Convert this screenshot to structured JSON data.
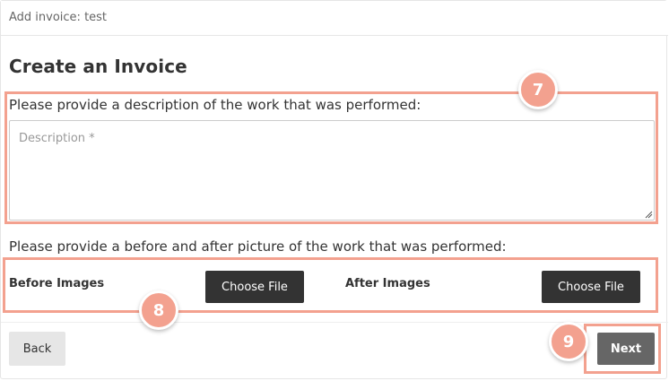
{
  "header": {
    "title": "Add invoice: test"
  },
  "form": {
    "title": "Create an Invoice",
    "description_prompt": "Please provide a description of the work that was performed:",
    "description_placeholder": "Description *",
    "description_value": "",
    "pictures_prompt": "Please provide a before and after picture of the work that was performed:",
    "before_label": "Before Images",
    "after_label": "After Images",
    "choose_file_label": "Choose File"
  },
  "footer": {
    "back_label": "Back",
    "next_label": "Next"
  },
  "annotations": [
    {
      "number": "7",
      "target": "description section"
    },
    {
      "number": "8",
      "target": "image upload section"
    },
    {
      "number": "9",
      "target": "next button"
    }
  ],
  "colors": {
    "annotation": "#f3a18f",
    "primary_button": "#333333",
    "next_button": "#666666",
    "secondary_button": "#e6e6e6"
  }
}
